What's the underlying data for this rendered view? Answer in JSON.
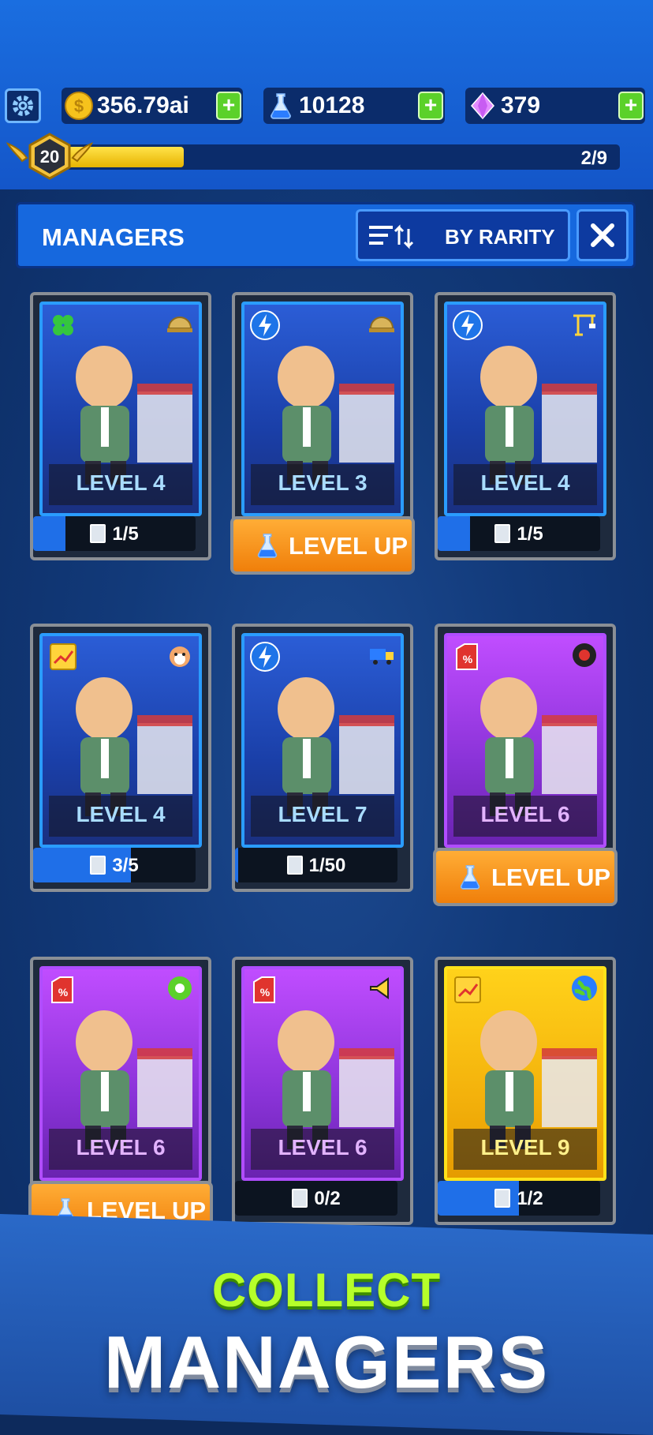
{
  "resources": {
    "coins": "356.79ai",
    "science": "10128",
    "gems": "379"
  },
  "player": {
    "level": "20",
    "xp_progress": "2/9",
    "xp_fraction": 0.21
  },
  "header": {
    "title": "MANAGERS",
    "sort_label": "BY RARITY"
  },
  "managers": [
    {
      "level": "LEVEL 4",
      "rarity": "rare",
      "type_icon": "clover-icon",
      "resource_icon": "helmet-icon",
      "status": "progress",
      "progress": "1/5",
      "fraction": 0.2
    },
    {
      "level": "LEVEL 3",
      "rarity": "rare",
      "type_icon": "lightning-icon",
      "resource_icon": "helmet-icon",
      "status": "levelup",
      "action": "LEVEL UP"
    },
    {
      "level": "LEVEL 4",
      "rarity": "rare",
      "type_icon": "lightning-icon",
      "resource_icon": "crane-icon",
      "status": "progress",
      "progress": "1/5",
      "fraction": 0.2
    },
    {
      "level": "LEVEL 4",
      "rarity": "rare",
      "type_icon": "chart-icon",
      "resource_icon": "hamster-icon",
      "status": "progress",
      "progress": "3/5",
      "fraction": 0.6
    },
    {
      "level": "LEVEL 7",
      "rarity": "rare",
      "type_icon": "lightning-icon",
      "resource_icon": "truck-icon",
      "status": "progress",
      "progress": "1/50",
      "fraction": 0.02
    },
    {
      "level": "LEVEL 6",
      "rarity": "epic",
      "type_icon": "discount-tag-icon",
      "resource_icon": "tire-icon",
      "status": "levelup",
      "action": "LEVEL UP"
    },
    {
      "level": "LEVEL 6",
      "rarity": "epic",
      "type_icon": "discount-tag-icon",
      "resource_icon": "tape-icon",
      "status": "levelup",
      "action": "LEVEL UP"
    },
    {
      "level": "LEVEL 6",
      "rarity": "epic",
      "type_icon": "discount-tag-icon",
      "resource_icon": "horn-icon",
      "status": "progress",
      "progress": "0/2",
      "fraction": 0.0
    },
    {
      "level": "LEVEL 9",
      "rarity": "legendary",
      "type_icon": "chart-icon",
      "resource_icon": "globe-icon",
      "status": "progress",
      "progress": "1/2",
      "fraction": 0.5
    }
  ],
  "promo": {
    "line1": "COLLECT",
    "line2": "MANAGERS"
  },
  "colors": {
    "rare": "#2a9cff",
    "epic": "#b04dff",
    "legendary": "#ffe21a",
    "levelup": "#f7951e",
    "plus": "#5bd12a"
  }
}
